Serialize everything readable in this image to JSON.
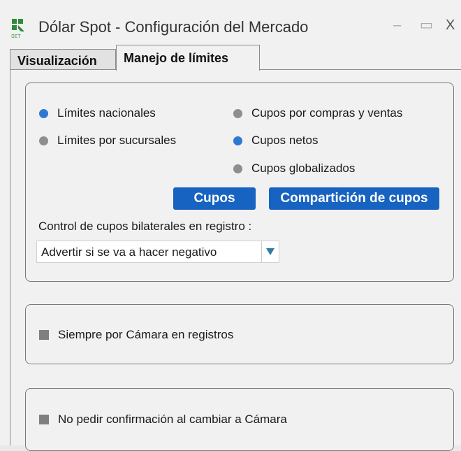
{
  "window": {
    "title": "Dólar Spot - Configuración del Mercado",
    "logo_icon": "set-icp-logo-icon",
    "controls": {
      "minimize": "–",
      "maximize": "▭",
      "close": "X"
    }
  },
  "tabs": [
    {
      "label": "Visualización",
      "active": false
    },
    {
      "label": "Manejo de límites",
      "active": true
    }
  ],
  "limits": {
    "left_options": [
      {
        "label": "Límites nacionales",
        "selected": true
      },
      {
        "label": "Límites por sucursales",
        "selected": false
      }
    ],
    "right_options": [
      {
        "label": "Cupos por compras y ventas",
        "selected": false
      },
      {
        "label": "Cupos netos",
        "selected": true
      },
      {
        "label": "Cupos globalizados",
        "selected": false
      }
    ],
    "buttons": {
      "cupos": "Cupos",
      "comparticion": "Compartición de cupos"
    },
    "control_label": "Control de cupos bilaterales en registro :",
    "control_select": {
      "value": "Advertir si se va a hacer negativo"
    }
  },
  "options": {
    "camara_registros": {
      "label": "Siempre por Cámara en registros",
      "checked": false
    },
    "no_confirmacion": {
      "label": "No pedir confirmación al cambiar a Cámara",
      "checked": false
    }
  },
  "colors": {
    "accent": "#1763c1",
    "radio_on": "#2e78d4",
    "radio_off": "#8e8e8e"
  }
}
